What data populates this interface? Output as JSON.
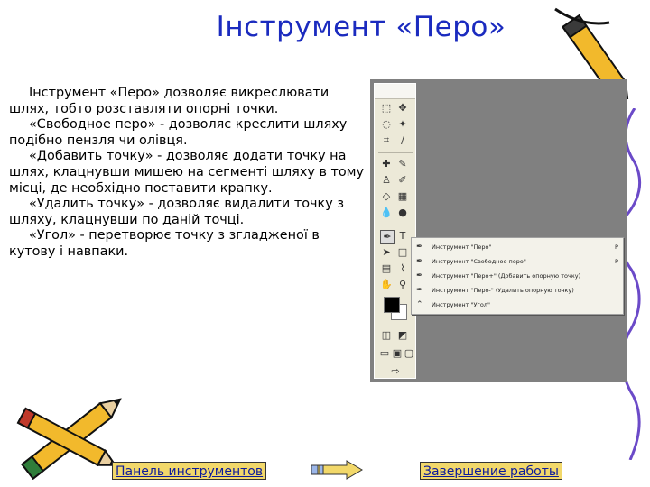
{
  "slide": {
    "title": "Інструмент «Перо»",
    "paragraphs": [
      "Інструмент «Перо» дозволяє викреслювати шлях, тобто розставляти опорні точки.",
      "«Свободное перо» - дозволяє креслити шляху подібно пензля чи олівця.",
      "«Добавить точку» - дозволяє додати точку на шлях, клацнувши мишею на сегменті шляху в тому місці, де необхідно поставити крапку.",
      "«Удалить точку» - дозволяє видалити точку з шляху, клацнувши по даній точці.",
      "«Угол» - перетворює точку з згладженої в кутову і навпаки."
    ]
  },
  "screenshot": {
    "menu_items": [
      {
        "icon": "pen-icon",
        "label": "Инструмент \"Перо\"",
        "shortcut": "P"
      },
      {
        "icon": "freeform-pen-icon",
        "label": "Инструмент \"Свободное перо\"",
        "shortcut": "P"
      },
      {
        "icon": "add-anchor-point-icon",
        "label": "Инструмент \"Перо+\" (Добавить опорную точку)",
        "shortcut": ""
      },
      {
        "icon": "delete-anchor-point-icon",
        "label": "Инструмент \"Перо-\" (Удалить опорную точку)",
        "shortcut": ""
      },
      {
        "icon": "convert-point-icon",
        "label": "Инструмент \"Угол\"",
        "shortcut": ""
      }
    ]
  },
  "nav": {
    "left_link": "Панель инструментов",
    "right_link": "Завершение работы",
    "arrow_icon": "double-arrow-icon"
  },
  "colors": {
    "title": "#1b2bbf",
    "link": "#0c1a9c",
    "link_bg": "#f2d86a",
    "pencil_body": "#f2b92c",
    "screenshot_bg": "#808080"
  }
}
